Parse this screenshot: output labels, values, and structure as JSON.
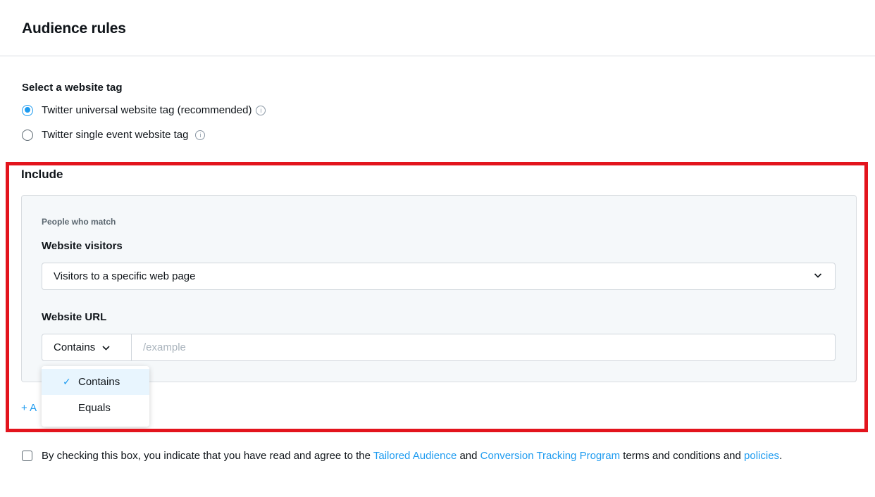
{
  "header": {
    "title": "Audience rules"
  },
  "tag_selection": {
    "label": "Select a website tag",
    "options": [
      {
        "label": "Twitter universal website tag (recommended)",
        "selected": true
      },
      {
        "label": "Twitter single event website tag",
        "selected": false
      }
    ],
    "info_glyph": "i"
  },
  "include": {
    "label": "Include",
    "people_match_label": "People who match",
    "visitors_label": "Website visitors",
    "visitors_value": "Visitors to a specific web page",
    "url_label": "Website URL",
    "match_type_value": "Contains",
    "url_placeholder": "/example",
    "add_link_text": "+ A",
    "dropdown": {
      "check_glyph": "✓",
      "options": [
        {
          "label": "Contains",
          "selected": true
        },
        {
          "label": "Equals",
          "selected": false
        }
      ]
    }
  },
  "terms": {
    "text_1": "By checking this box, you indicate that you have read and agree to the ",
    "link_1": "Tailored Audience",
    "text_2": " and ",
    "link_2": "Conversion Tracking Program",
    "text_3": " terms and conditions and ",
    "link_3": "policies",
    "text_4": "."
  },
  "colors": {
    "accent": "#1d9bf0",
    "highlight_border": "#e3141d",
    "panel_background": "#f5f8fa"
  }
}
